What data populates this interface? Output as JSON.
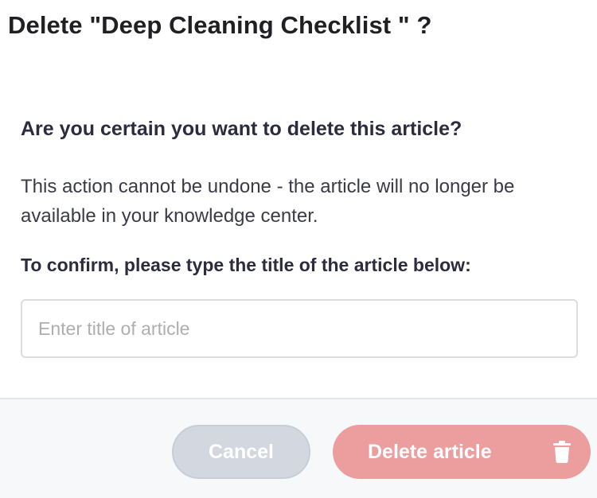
{
  "dialog": {
    "title": "Delete \"Deep Cleaning Checklist \" ?",
    "question": "Are you certain you want to delete this article?",
    "warning": "This action cannot be undone - the article will no longer be available in your knowledge center.",
    "confirm_label": "To confirm, please type the title of the article below:",
    "input": {
      "placeholder": "Enter title of article",
      "value": ""
    }
  },
  "footer": {
    "cancel_label": "Cancel",
    "delete_label": "Delete article",
    "delete_icon": "trash-icon"
  },
  "colors": {
    "delete_button": "#ec9d9d",
    "cancel_button": "#d3d7df",
    "footer_background": "#f7f8fa"
  }
}
